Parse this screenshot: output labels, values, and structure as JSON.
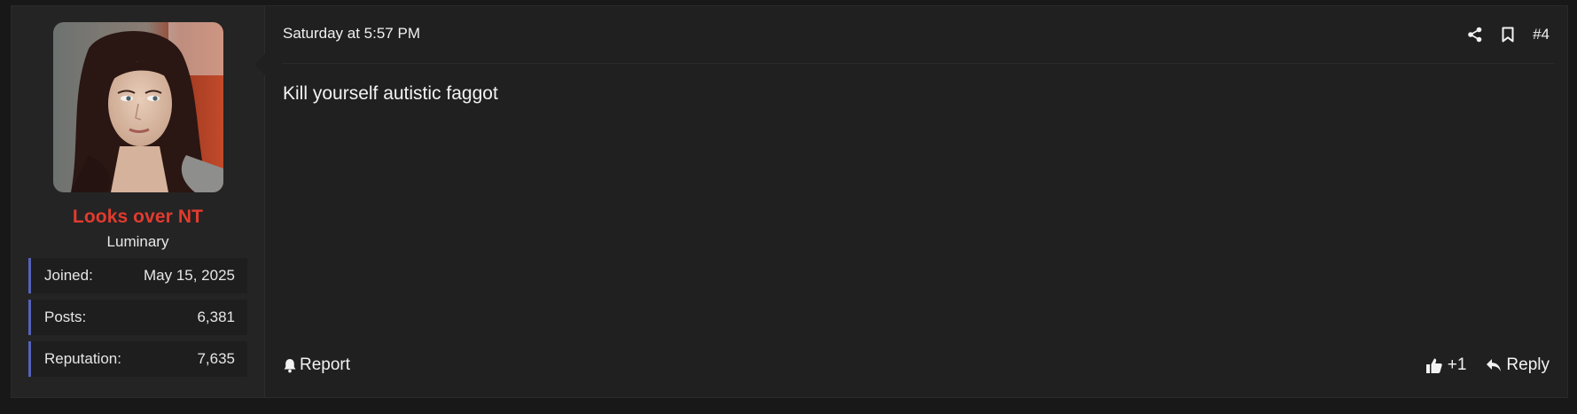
{
  "post": {
    "date": "Saturday at 5:57 PM",
    "number": "#4",
    "body": "Kill yourself autistic faggot"
  },
  "user": {
    "name": "Looks over NT",
    "title": "Luminary",
    "name_color": "#e23b2e",
    "stats": [
      {
        "label": "Joined:",
        "value": "May 15, 2025"
      },
      {
        "label": "Posts:",
        "value": "6,381"
      },
      {
        "label": "Reputation:",
        "value": "7,635"
      }
    ]
  },
  "icons": {
    "share": "share-icon",
    "bookmark": "bookmark-icon",
    "report": "bell-icon",
    "like": "thumbs-up-icon",
    "reply": "reply-arrow-icon"
  },
  "footer": {
    "report_label": "Report",
    "reaction_count": "+1",
    "reply_label": "Reply"
  },
  "colors": {
    "accent_border": "#5563b8",
    "background": "#202020"
  }
}
